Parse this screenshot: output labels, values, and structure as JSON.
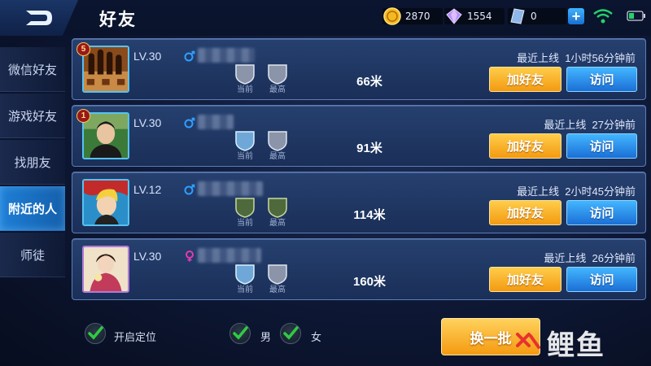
{
  "header": {
    "title": "好友",
    "gold": "2870",
    "gems": "1554",
    "coupons": "0",
    "plus": "+"
  },
  "sidebar": {
    "items": [
      {
        "label": "微信好友",
        "active": false
      },
      {
        "label": "游戏好友",
        "active": false
      },
      {
        "label": "找朋友",
        "active": false
      },
      {
        "label": "附近的人",
        "active": true
      },
      {
        "label": "师徒",
        "active": false
      }
    ]
  },
  "players": [
    {
      "rank_badge": "5",
      "level": "LV.30",
      "gender": "male",
      "rank_current_label": "当前",
      "rank_max_label": "最高",
      "rank_current_tier": "IV",
      "rank_max_tier": "IV",
      "distance": "66米",
      "last_online": "最近上线  1小时56分钟前",
      "add_label": "加好友",
      "visit_label": "访问"
    },
    {
      "rank_badge": "1",
      "level": "LV.30",
      "gender": "male",
      "rank_current_label": "当前",
      "rank_max_label": "最高",
      "rank_current_tier": "II",
      "rank_max_tier": "IV",
      "distance": "91米",
      "last_online": "最近上线  27分钟前",
      "add_label": "加好友",
      "visit_label": "访问"
    },
    {
      "rank_badge": "",
      "level": "LV.12",
      "gender": "male",
      "rank_current_label": "当前",
      "rank_max_label": "最高",
      "rank_current_tier": "II",
      "rank_max_tier": "II",
      "distance": "114米",
      "last_online": "最近上线  2小时45分钟前",
      "add_label": "加好友",
      "visit_label": "访问"
    },
    {
      "rank_badge": "",
      "level": "LV.30",
      "gender": "female",
      "rank_current_label": "当前",
      "rank_max_label": "最高",
      "rank_current_tier": "II",
      "rank_max_tier": "III",
      "distance": "160米",
      "last_online": "最近上线  26分钟前",
      "add_label": "加好友",
      "visit_label": "访问"
    }
  ],
  "footer": {
    "location_label": "开启定位",
    "male_label": "男",
    "female_label": "女",
    "location_checked": true,
    "male_checked": true,
    "female_checked": true,
    "refresh_label": "换一批"
  },
  "watermark": "鲤鱼",
  "colors": {
    "accent_blue": "#1e7fd6",
    "button_orange": "#f39a12",
    "button_blue": "#1b6fd6",
    "check_green": "#2ecc40",
    "wifi_green": "#22d36b"
  },
  "icons": [
    "back-icon",
    "gold-coin-icon",
    "diamond-icon",
    "coupon-icon",
    "plus-icon",
    "wifi-icon",
    "battery-icon",
    "male-icon",
    "female-icon",
    "rank-shield-icon",
    "checkmark-icon"
  ]
}
